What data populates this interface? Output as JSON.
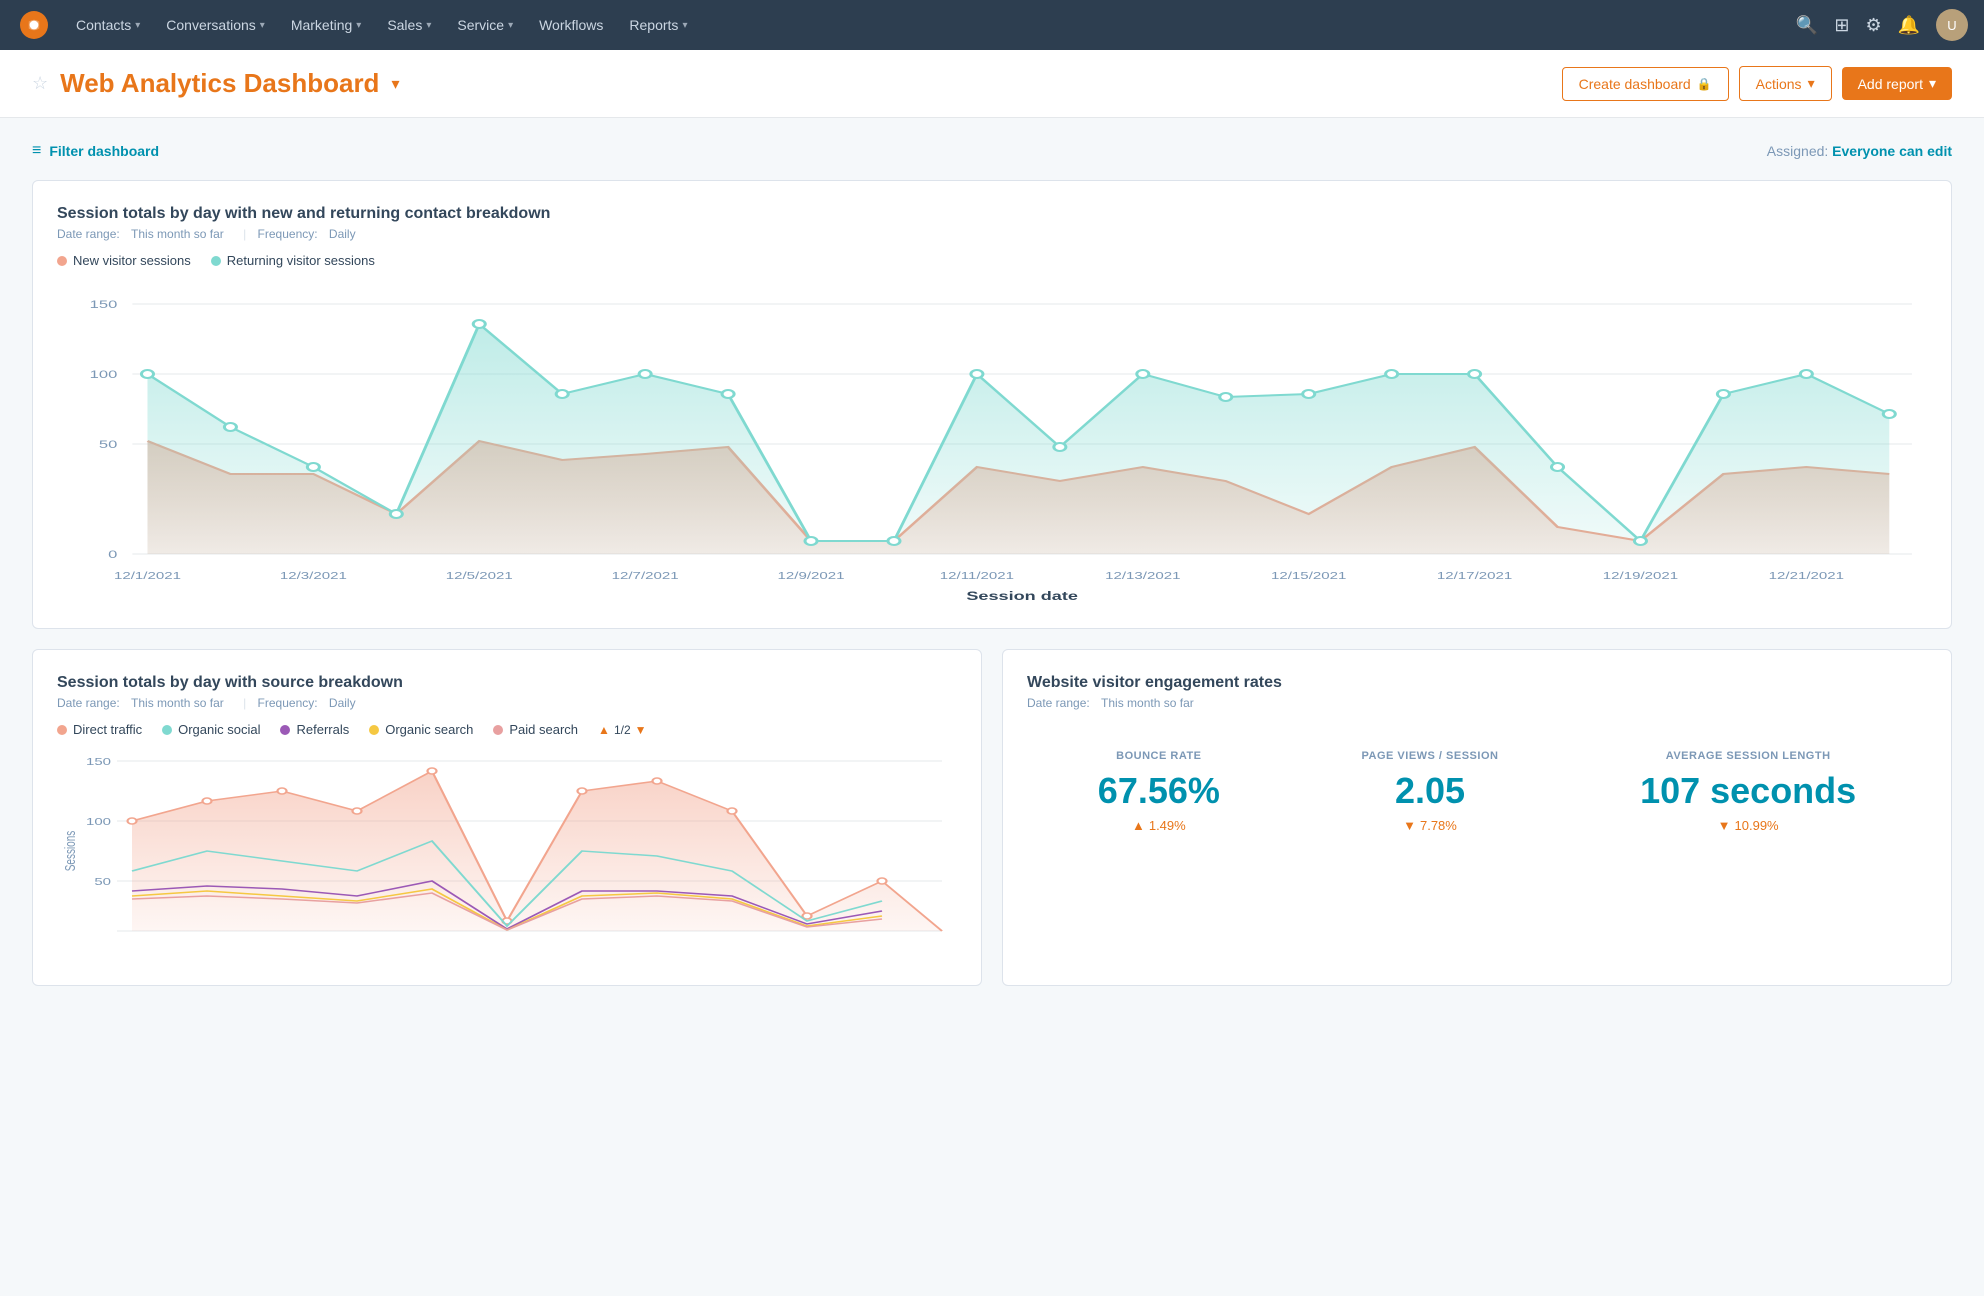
{
  "nav": {
    "items": [
      {
        "label": "Contacts",
        "has_dropdown": true
      },
      {
        "label": "Conversations",
        "has_dropdown": true
      },
      {
        "label": "Marketing",
        "has_dropdown": true
      },
      {
        "label": "Sales",
        "has_dropdown": true
      },
      {
        "label": "Service",
        "has_dropdown": true
      },
      {
        "label": "Workflows",
        "has_dropdown": false
      },
      {
        "label": "Reports",
        "has_dropdown": true
      }
    ]
  },
  "header": {
    "title": "Web Analytics Dashboard",
    "create_dashboard_label": "Create dashboard",
    "actions_label": "Actions",
    "add_report_label": "Add report"
  },
  "filter": {
    "label": "Filter dashboard",
    "assigned_label": "Assigned:",
    "assigned_value": "Everyone can edit"
  },
  "chart1": {
    "title": "Session totals by day with new and returning contact breakdown",
    "date_range": "This month so far",
    "frequency": "Daily",
    "legend": [
      {
        "label": "New visitor sessions",
        "color": "#f2a58e"
      },
      {
        "label": "Returning visitor sessions",
        "color": "#7fd9d0"
      }
    ],
    "y_labels": [
      "0",
      "50",
      "100",
      "150"
    ],
    "x_labels": [
      "12/1/2021",
      "12/3/2021",
      "12/5/2021",
      "12/7/2021",
      "12/9/2021",
      "12/11/2021",
      "12/13/2021",
      "12/15/2021",
      "12/17/2021",
      "12/19/2021",
      "12/21/2021"
    ],
    "x_axis_label": "Session date"
  },
  "chart2": {
    "title": "Session totals by day with source breakdown",
    "date_range": "This month so far",
    "frequency": "Daily",
    "legend": [
      {
        "label": "Direct traffic",
        "color": "#f2a58e"
      },
      {
        "label": "Organic social",
        "color": "#7fd9d0"
      },
      {
        "label": "Referrals",
        "color": "#9b59b6"
      },
      {
        "label": "Organic search",
        "color": "#f5c842"
      },
      {
        "label": "Paid search",
        "color": "#e8a0a0"
      }
    ],
    "y_labels": [
      "50",
      "100",
      "150"
    ],
    "page_nav": "1/2"
  },
  "engagement": {
    "title": "Website visitor engagement rates",
    "date_range": "This month so far",
    "metrics": [
      {
        "label": "BOUNCE RATE",
        "value": "67.56%",
        "change": "1.49%",
        "change_direction": "up"
      },
      {
        "label": "PAGE VIEWS / SESSION",
        "value": "2.05",
        "change": "7.78%",
        "change_direction": "down"
      },
      {
        "label": "AVERAGE SESSION LENGTH",
        "value": "107 seconds",
        "change": "10.99%",
        "change_direction": "down"
      }
    ]
  }
}
